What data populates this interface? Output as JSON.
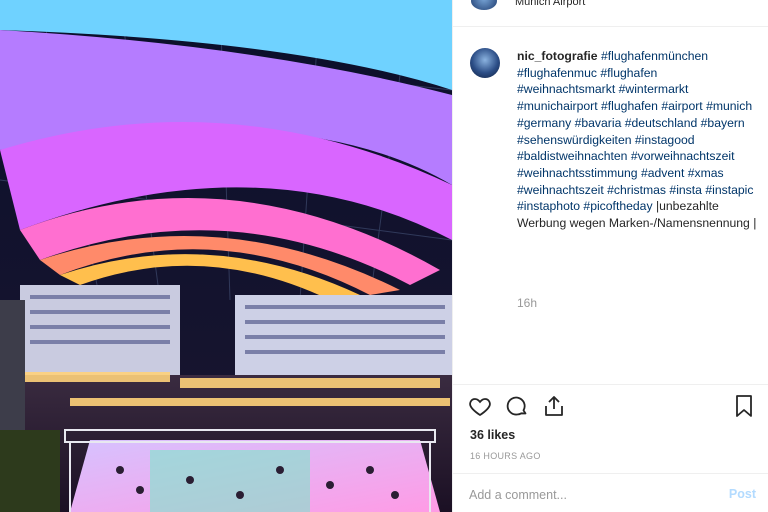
{
  "post": {
    "location": "Munich Airport",
    "username": "nic_fotografie",
    "caption_parts": [
      {
        "type": "tag",
        "text": "#flughafenmünchen"
      },
      {
        "type": "tag",
        "text": "#flughafenmuc"
      },
      {
        "type": "tag",
        "text": "#flughafen"
      },
      {
        "type": "tag",
        "text": "#weihnachtsmarkt"
      },
      {
        "type": "tag",
        "text": "#wintermarkt"
      },
      {
        "type": "tag",
        "text": "#munichairport"
      },
      {
        "type": "tag",
        "text": "#flughafen"
      },
      {
        "type": "tag",
        "text": "#airport"
      },
      {
        "type": "tag",
        "text": "#munich"
      },
      {
        "type": "tag",
        "text": "#germany"
      },
      {
        "type": "tag",
        "text": "#bavaria"
      },
      {
        "type": "tag",
        "text": "#deutschland"
      },
      {
        "type": "tag",
        "text": "#bayern"
      },
      {
        "type": "tag",
        "text": "#sehenswürdigkeiten"
      },
      {
        "type": "tag",
        "text": "#instagood"
      },
      {
        "type": "tag",
        "text": "#baldistweihnachten"
      },
      {
        "type": "tag",
        "text": "#vorweihnachtszeit"
      },
      {
        "type": "tag",
        "text": "#weihnachtsstimmung"
      },
      {
        "type": "tag",
        "text": "#advent"
      },
      {
        "type": "tag",
        "text": "#xmas"
      },
      {
        "type": "tag",
        "text": "#weihnachtszeit"
      },
      {
        "type": "tag",
        "text": "#christmas"
      },
      {
        "type": "tag",
        "text": "#insta"
      },
      {
        "type": "tag",
        "text": "#instapic"
      },
      {
        "type": "tag",
        "text": "#instaphoto"
      },
      {
        "type": "tag",
        "text": "#picoftheday"
      },
      {
        "type": "text",
        "text": "|unbezahlte Werbung wegen Marken-/Namensnennung |"
      }
    ],
    "comment_age": "16h",
    "likes": "36 likes",
    "posted_ago": "16 HOURS AGO",
    "comment_placeholder": "Add a comment...",
    "post_label": "Post"
  },
  "icons": {
    "like": "heart-icon",
    "comment": "comment-icon",
    "share": "share-icon",
    "save": "bookmark-icon"
  },
  "colors": {
    "hashtag": "#003569",
    "muted": "#999999",
    "post_disabled": "#b3dbff"
  }
}
